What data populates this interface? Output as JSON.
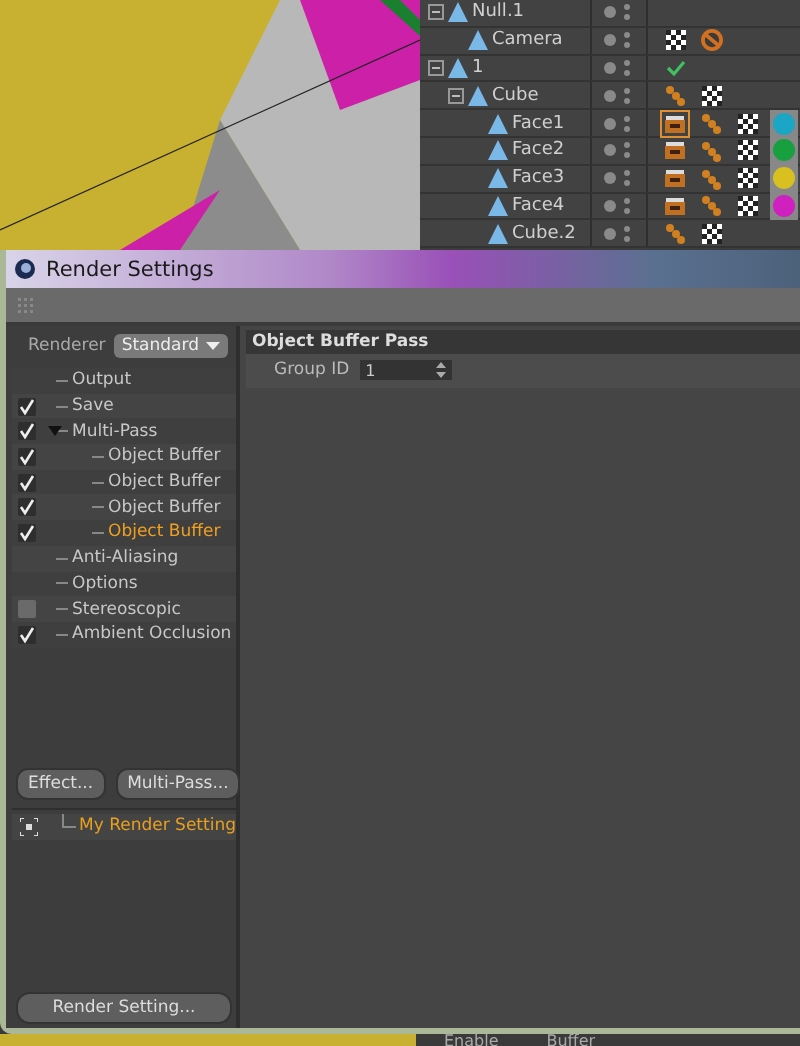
{
  "object_manager": {
    "items": [
      {
        "name": "Null.1",
        "expanded": true,
        "children": [
          {
            "name": "Camera",
            "tags": [
              {
                "kind": "checker",
                "selected": false
              },
              {
                "kind": "prohibit",
                "selected": false
              }
            ]
          }
        ]
      },
      {
        "name": "1",
        "expanded": true,
        "tags": [
          {
            "kind": "check",
            "selected": false
          }
        ],
        "children": [
          {
            "name": "Cube",
            "expanded": true,
            "tags": [
              {
                "kind": "dots",
                "selected": false
              },
              {
                "kind": "checker",
                "selected": false
              }
            ],
            "children": [
              {
                "name": "Face1",
                "tags": [
                  {
                    "kind": "clapper",
                    "selected": true
                  },
                  {
                    "kind": "dots",
                    "selected": false
                  },
                  {
                    "kind": "checker",
                    "selected": false
                  },
                  {
                    "kind": "sphere",
                    "color": "#1aa6c4",
                    "selected": false
                  }
                ]
              },
              {
                "name": "Face2",
                "tags": [
                  {
                    "kind": "clapper",
                    "selected": false
                  },
                  {
                    "kind": "dots",
                    "selected": false
                  },
                  {
                    "kind": "checker",
                    "selected": false
                  },
                  {
                    "kind": "sphere",
                    "color": "#18a040",
                    "selected": false
                  }
                ]
              },
              {
                "name": "Face3",
                "tags": [
                  {
                    "kind": "clapper",
                    "selected": false
                  },
                  {
                    "kind": "dots",
                    "selected": false
                  },
                  {
                    "kind": "checker",
                    "selected": false
                  },
                  {
                    "kind": "sphere",
                    "color": "#d8c020",
                    "selected": false
                  }
                ]
              },
              {
                "name": "Face4",
                "tags": [
                  {
                    "kind": "clapper",
                    "selected": false
                  },
                  {
                    "kind": "dots",
                    "selected": false
                  },
                  {
                    "kind": "checker",
                    "selected": false
                  },
                  {
                    "kind": "sphere",
                    "color": "#d020c0",
                    "selected": false
                  }
                ]
              },
              {
                "name": "Cube.2",
                "tags": [
                  {
                    "kind": "dots",
                    "selected": false
                  },
                  {
                    "kind": "checker",
                    "selected": false
                  }
                ]
              }
            ]
          }
        ]
      }
    ]
  },
  "render_settings": {
    "title": "Render Settings",
    "renderer_label": "Renderer",
    "renderer": "Standard",
    "tree": [
      {
        "label": "Output",
        "kind": "plain",
        "selected": false
      },
      {
        "label": "Save",
        "kind": "toggle",
        "checked": true,
        "selected": false
      },
      {
        "label": "Multi-Pass",
        "kind": "toggle",
        "checked": true,
        "selected": false,
        "expanded": true,
        "children": [
          {
            "label": "Object Buffer",
            "kind": "toggle",
            "checked": true,
            "selected": false
          },
          {
            "label": "Object Buffer",
            "kind": "toggle",
            "checked": true,
            "selected": false
          },
          {
            "label": "Object Buffer",
            "kind": "toggle",
            "checked": true,
            "selected": false
          },
          {
            "label": "Object Buffer",
            "kind": "toggle",
            "checked": true,
            "selected": true
          }
        ]
      },
      {
        "label": "Anti-Aliasing",
        "kind": "plain",
        "selected": false
      },
      {
        "label": "Options",
        "kind": "plain",
        "selected": false
      },
      {
        "label": "Stereoscopic",
        "kind": "toggle",
        "checked": false,
        "selected": false
      },
      {
        "label": "Ambient Occlusion",
        "kind": "toggle",
        "checked": true,
        "selected": false
      }
    ],
    "buttons": [
      "Effect...",
      "Multi-Pass..."
    ],
    "settings": [
      {
        "label": "My Render Setting",
        "selected": true
      }
    ],
    "bottom_button": "Render Setting...",
    "panel_title": "Object Buffer Pass",
    "fields": [
      {
        "label": "Group ID",
        "value": "1"
      }
    ]
  },
  "attribute_strip": {
    "labels": [
      "Enable",
      "Buffer"
    ]
  }
}
